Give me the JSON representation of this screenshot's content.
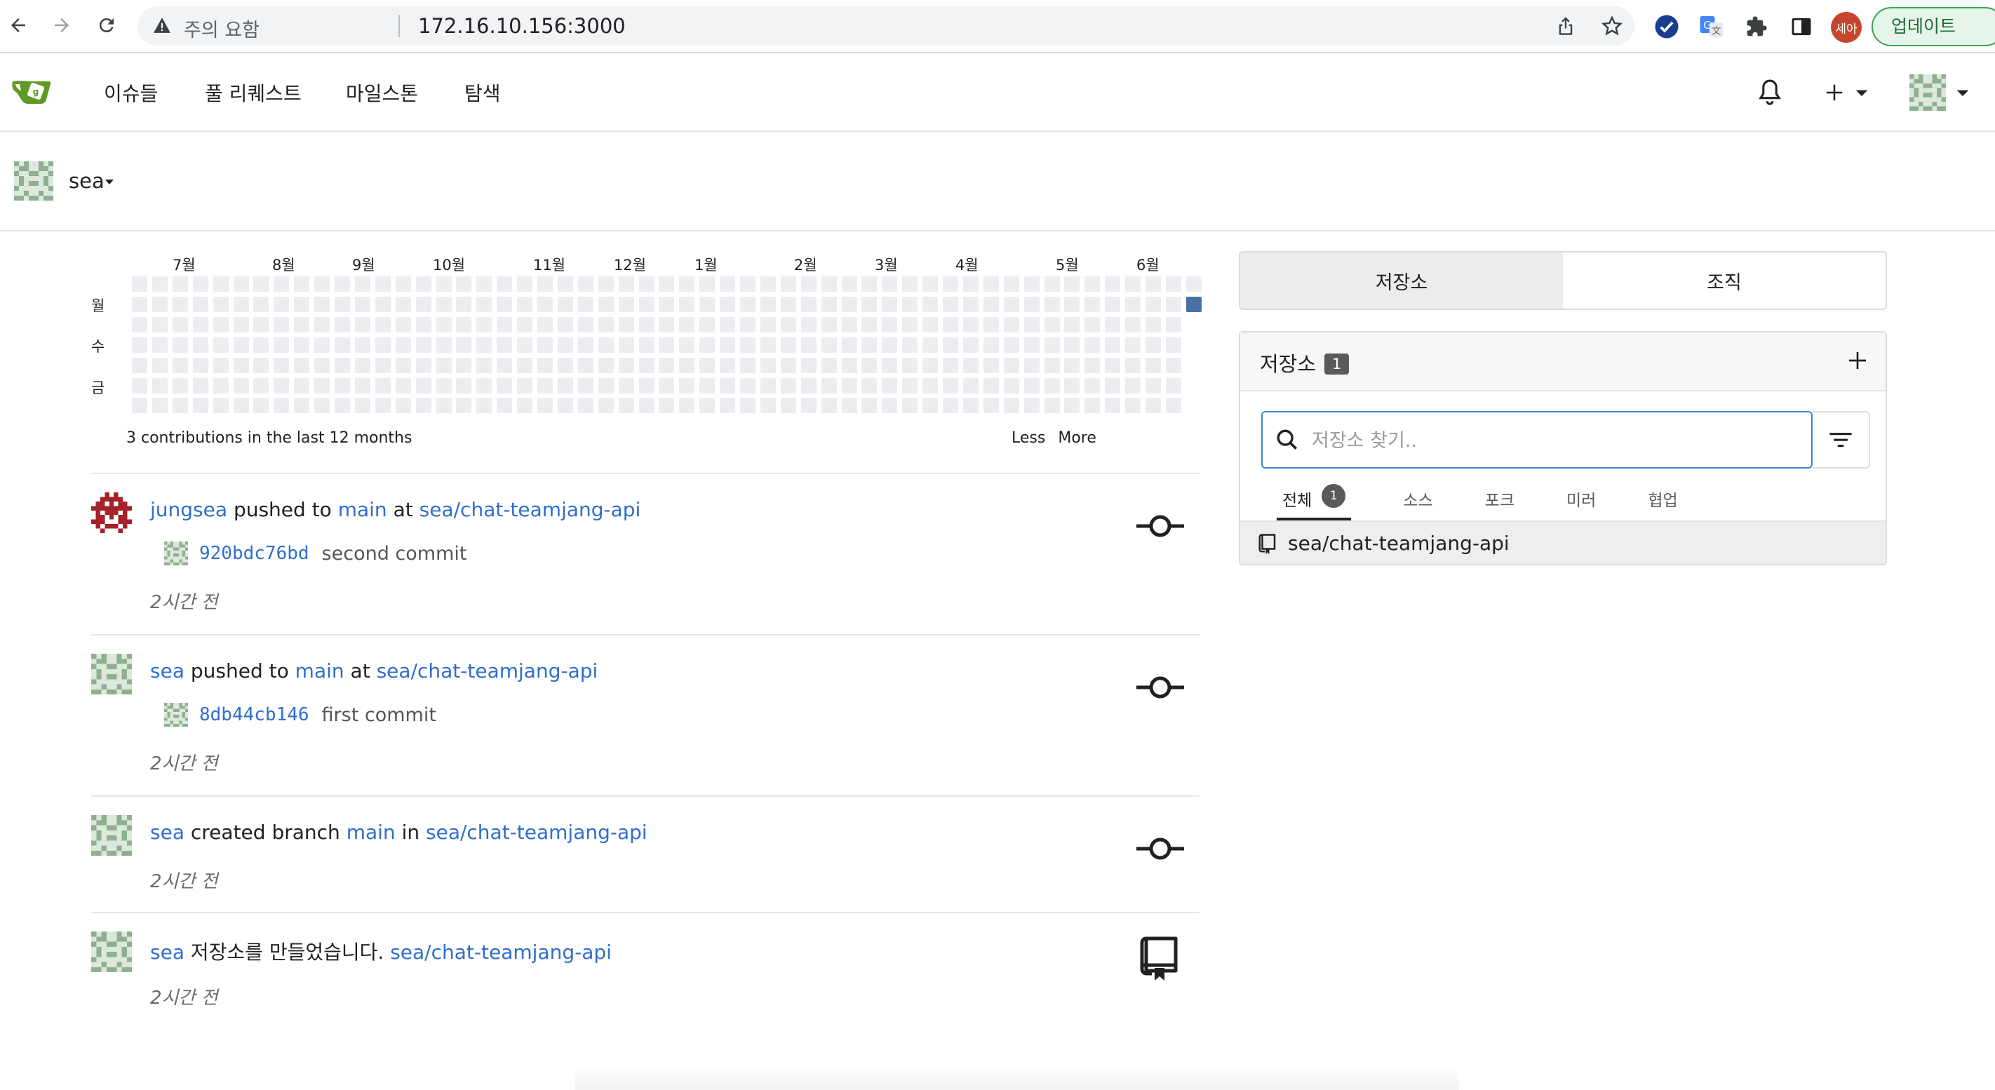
{
  "browser": {
    "warning_text": "주의 요함",
    "url": "172.16.10.156:3000",
    "profile_label": "세아",
    "update_label": "업데이트"
  },
  "navbar": {
    "items": [
      "이슈들",
      "풀 리퀘스트",
      "마일스톤",
      "탐색"
    ]
  },
  "context": {
    "username": "sea"
  },
  "heatmap": {
    "months": [
      "7월",
      "8월",
      "9월",
      "10월",
      "11월",
      "12월",
      "1월",
      "2월",
      "3월",
      "4월",
      "5월",
      "6월"
    ],
    "days": [
      "월",
      "수",
      "금"
    ],
    "summary": "3 contributions in the last 12 months",
    "legend_less": "Less",
    "legend_more": "More",
    "colors": {
      "empty": "#ebedf0",
      "active": "#4a6fa5",
      "scale": [
        "#ebedf0",
        "#a8c4e8",
        "#7ea6db",
        "#4f7fc4",
        "#3a64a6",
        "#2b4d80"
      ]
    }
  },
  "feed": [
    {
      "actor": "jungsea",
      "action": "pushed to",
      "branch": "main",
      "prep": "at",
      "repo": "sea/chat-teamjang-api",
      "commit_sha": "920bdc76bd",
      "commit_msg": "second commit",
      "time": "2시간 전",
      "icon": "commit-icon"
    },
    {
      "actor": "sea",
      "action": "pushed to",
      "branch": "main",
      "prep": "at",
      "repo": "sea/chat-teamjang-api",
      "commit_sha": "8db44cb146",
      "commit_msg": "first commit",
      "time": "2시간 전",
      "icon": "commit-icon"
    },
    {
      "actor": "sea",
      "action": "created branch",
      "branch": "main",
      "prep": "in",
      "repo": "sea/chat-teamjang-api",
      "time": "2시간 전",
      "icon": "branch-commit-icon"
    },
    {
      "actor": "sea",
      "action": "저장소를 만들었습니다.",
      "repo": "sea/chat-teamjang-api",
      "time": "2시간 전",
      "icon": "repo-icon"
    }
  ],
  "sidebar": {
    "tabs": [
      "저장소",
      "조직"
    ],
    "repo_title": "저장소",
    "repo_count": "1",
    "search_placeholder": "저장소 찾기..",
    "filter_tabs": [
      "전체",
      "소스",
      "포크",
      "미러",
      "협업"
    ],
    "filter_all_count": "1",
    "repos": [
      "sea/chat-teamjang-api"
    ]
  }
}
